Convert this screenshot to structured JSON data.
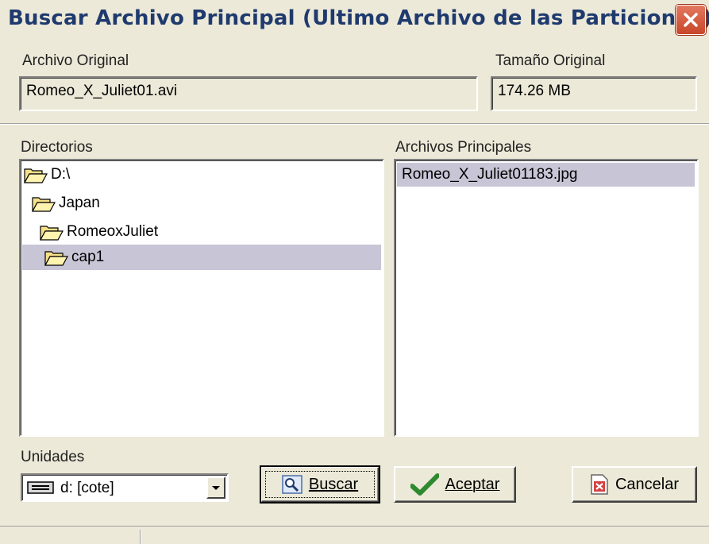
{
  "window": {
    "title": "Buscar Archivo Principal (Ultimo Archivo de las Particiones)",
    "close_icon": "close-icon"
  },
  "original_file": {
    "label": "Archivo Original",
    "value": "Romeo_X_Juliet01.avi"
  },
  "original_size": {
    "label": "Tamaño Original",
    "value": "174.26 MB"
  },
  "directories": {
    "label": "Directorios",
    "items": [
      {
        "label": "D:\\",
        "icon": "open-folder-icon",
        "selected": false
      },
      {
        "label": "Japan",
        "icon": "open-folder-icon",
        "selected": false
      },
      {
        "label": "RomeoxJuliet",
        "icon": "open-folder-icon",
        "selected": false
      },
      {
        "label": "cap1",
        "icon": "open-folder-icon",
        "selected": true
      }
    ]
  },
  "main_files": {
    "label": "Archivos Principales",
    "items": [
      {
        "label": "Romeo_X_Juliet01183.jpg",
        "selected": true
      }
    ]
  },
  "drives": {
    "label": "Unidades",
    "selected": "d: [cote]",
    "icon": "drive-icon"
  },
  "buttons": {
    "search": {
      "label": "Buscar",
      "icon": "magnifier-icon"
    },
    "accept": {
      "label": "Aceptar",
      "icon": "checkmark-icon"
    },
    "cancel": {
      "label": "Cancelar",
      "icon": "cancel-icon"
    }
  },
  "colors": {
    "title_text": "#1f3a6e",
    "selection": "#c7c5d6",
    "dialog_bg": "#ece9d8",
    "close_button": "#c8462a"
  }
}
